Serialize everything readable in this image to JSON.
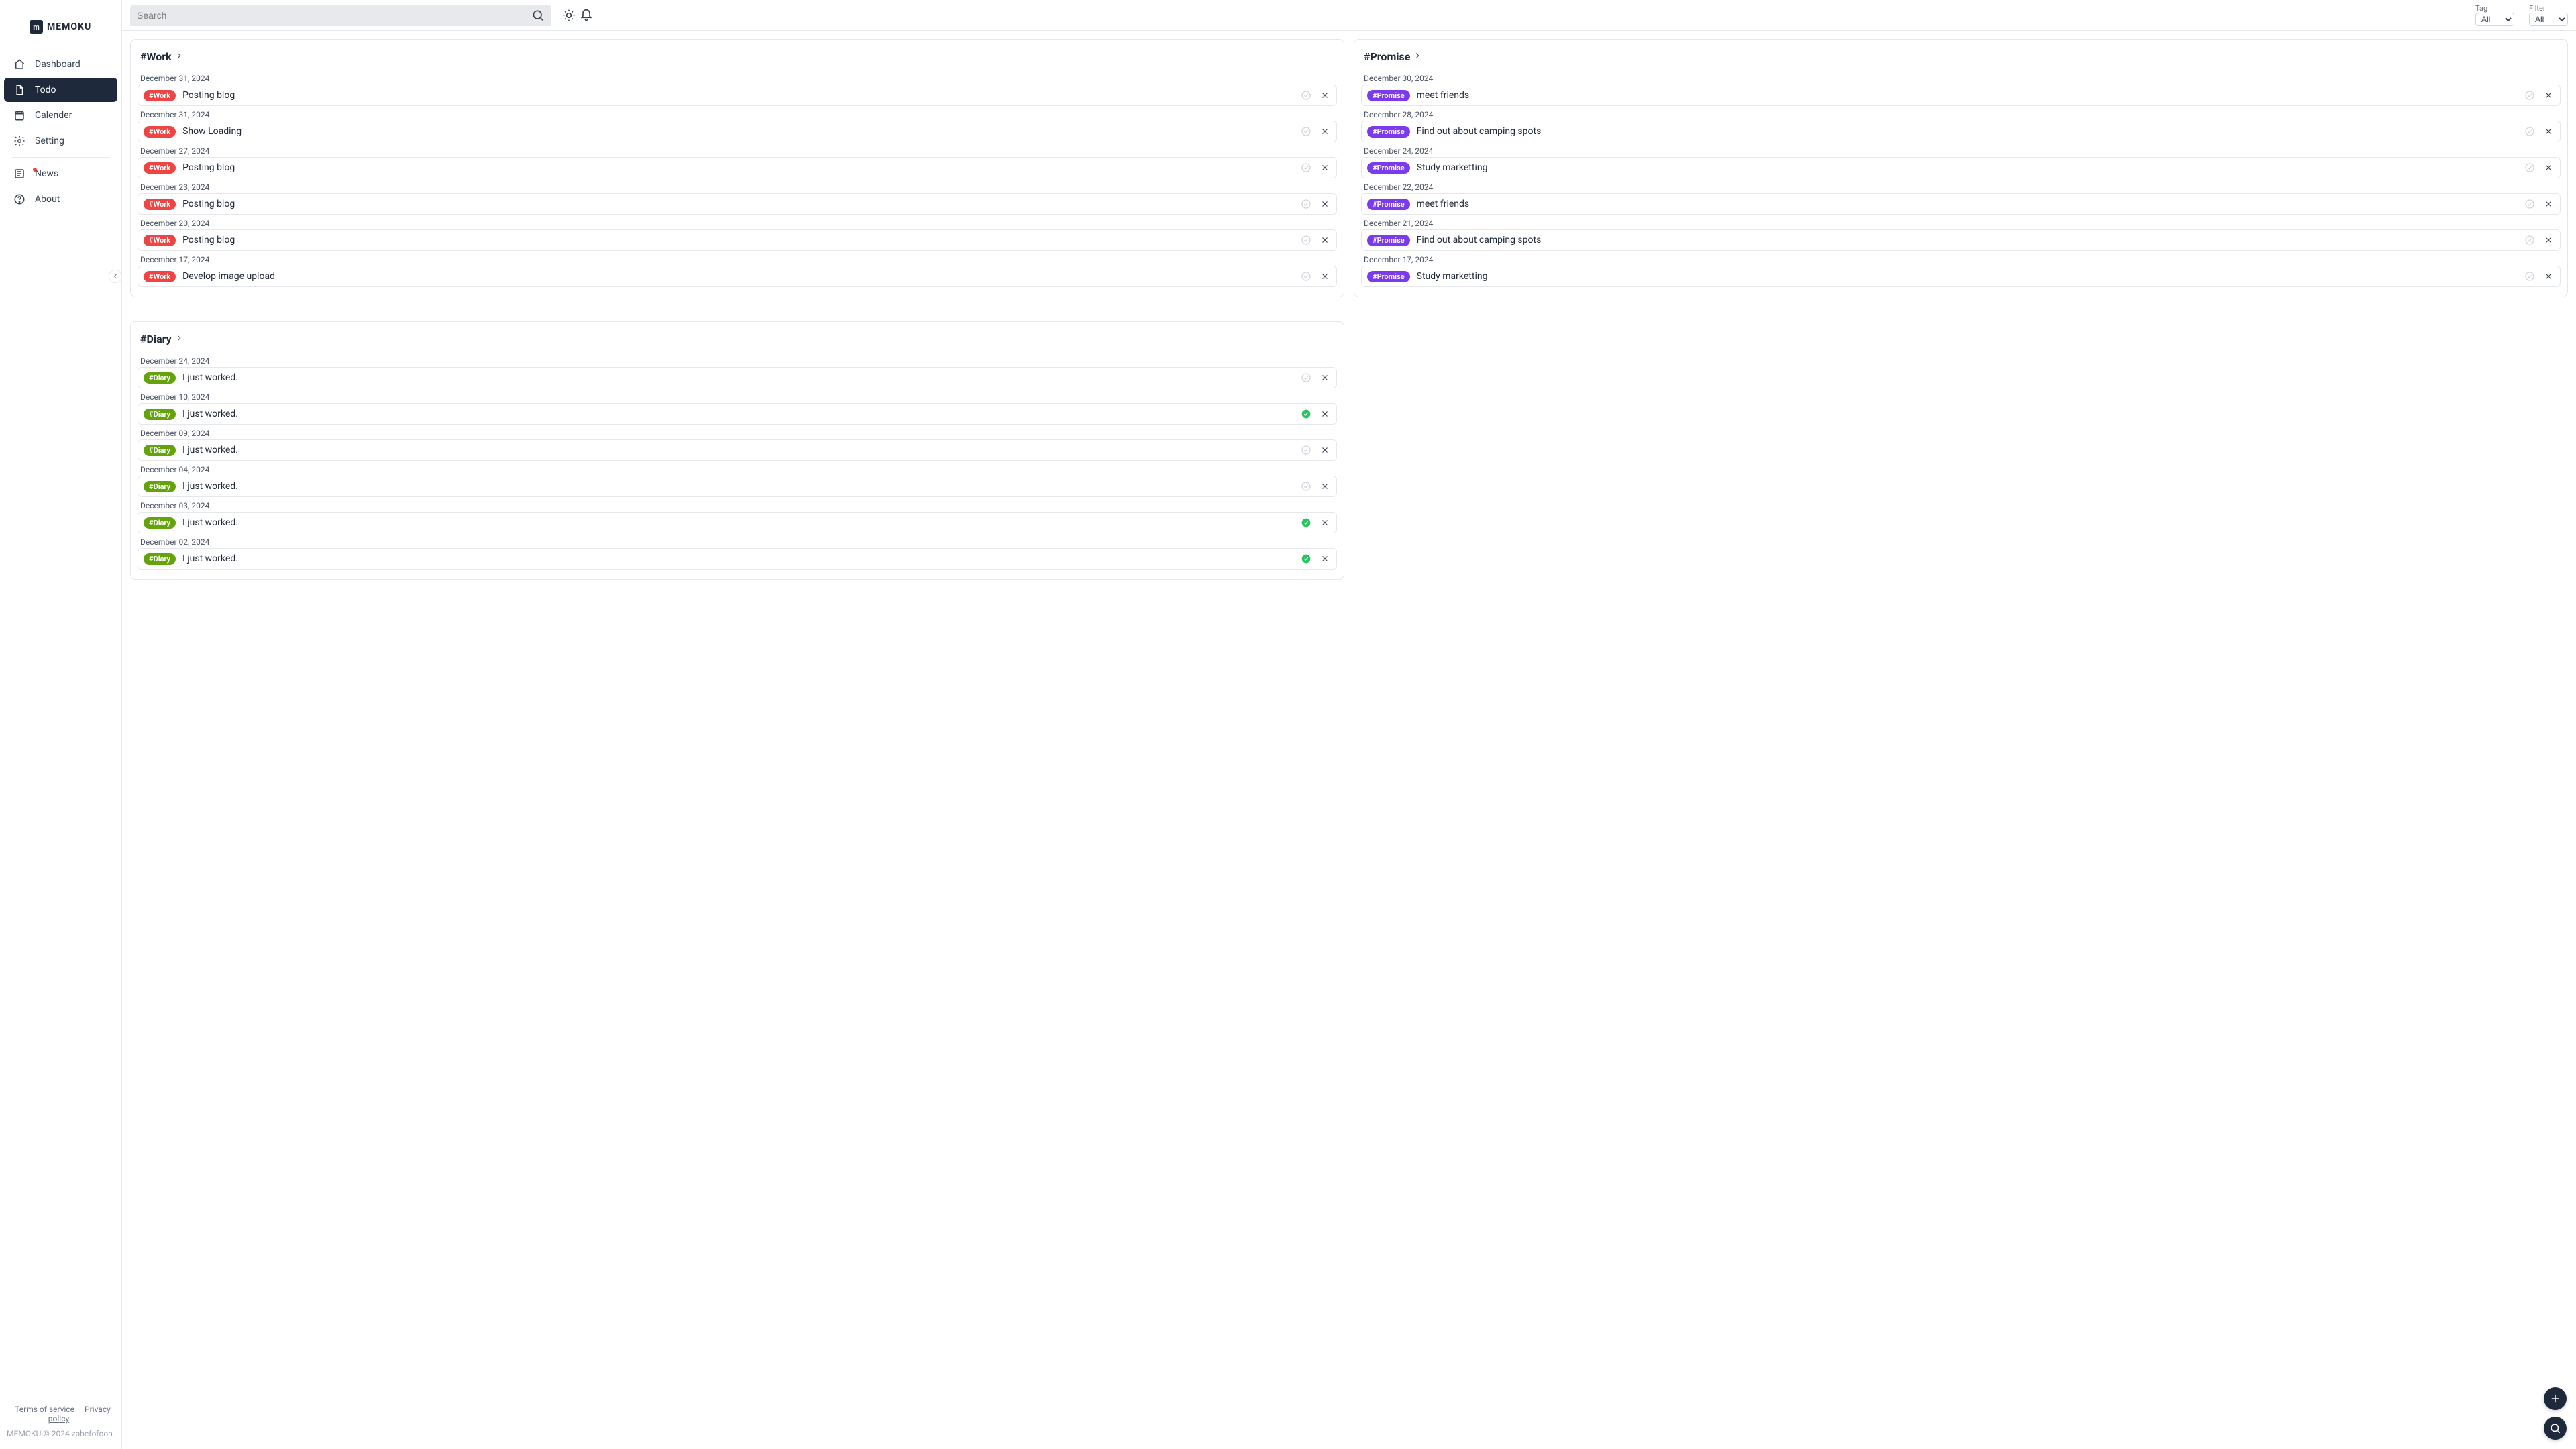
{
  "brand": {
    "mark": "m",
    "name": "MEMOKU"
  },
  "nav": [
    {
      "key": "dashboard",
      "label": "Dashboard",
      "active": false
    },
    {
      "key": "todo",
      "label": "Todo",
      "active": true
    },
    {
      "key": "calender",
      "label": "Calender",
      "active": false
    },
    {
      "key": "setting",
      "label": "Setting",
      "active": false
    }
  ],
  "nav2": [
    {
      "key": "news",
      "label": "News",
      "badge": true
    },
    {
      "key": "about",
      "label": "About"
    }
  ],
  "footer": {
    "terms": "Terms of service",
    "privacy": "Privacy policy",
    "copy": "MEMOKU © 2024 zabefofoon."
  },
  "search": {
    "placeholder": "Search"
  },
  "filters": {
    "tag": {
      "label": "Tag",
      "selected": "All",
      "options": [
        "All"
      ]
    },
    "filter": {
      "label": "Filter",
      "selected": "All",
      "options": [
        "All"
      ]
    }
  },
  "tags": {
    "Work": {
      "display": "#Work",
      "color": "#ef4444"
    },
    "Promise": {
      "display": "#Promise",
      "color": "#7c3aed"
    },
    "Diary": {
      "display": "#Diary",
      "color": "#65a30d"
    }
  },
  "columns": [
    {
      "title": "#Work",
      "tag": "Work",
      "items": [
        {
          "date": "December 31, 2024",
          "text": "Posting blog",
          "done": false
        },
        {
          "date": "December 31, 2024",
          "text": "Show Loading",
          "done": false
        },
        {
          "date": "December 27, 2024",
          "text": "Posting blog",
          "done": false
        },
        {
          "date": "December 23, 2024",
          "text": "Posting blog",
          "done": false
        },
        {
          "date": "December 20, 2024",
          "text": "Posting blog",
          "done": false
        },
        {
          "date": "December 17, 2024",
          "text": "Develop image upload",
          "done": false
        }
      ]
    },
    {
      "title": "#Promise",
      "tag": "Promise",
      "items": [
        {
          "date": "December 30, 2024",
          "text": "meet friends",
          "done": false
        },
        {
          "date": "December 28, 2024",
          "text": "Find out about camping spots",
          "done": false
        },
        {
          "date": "December 24, 2024",
          "text": "Study marketting",
          "done": false
        },
        {
          "date": "December 22, 2024",
          "text": "meet friends",
          "done": false
        },
        {
          "date": "December 21, 2024",
          "text": "Find out about camping spots",
          "done": false
        },
        {
          "date": "December 17, 2024",
          "text": "Study marketting",
          "done": false
        }
      ]
    },
    {
      "title": "#Diary",
      "tag": "Diary",
      "items": [
        {
          "date": "December 24, 2024",
          "text": "I just worked.",
          "done": false
        },
        {
          "date": "December 10, 2024",
          "text": "I just worked.",
          "done": true
        },
        {
          "date": "December 09, 2024",
          "text": "I just worked.",
          "done": false
        },
        {
          "date": "December 04, 2024",
          "text": "I just worked.",
          "done": false
        },
        {
          "date": "December 03, 2024",
          "text": "I just worked.",
          "done": true
        },
        {
          "date": "December 02, 2024",
          "text": "I just worked.",
          "done": true
        }
      ]
    }
  ]
}
